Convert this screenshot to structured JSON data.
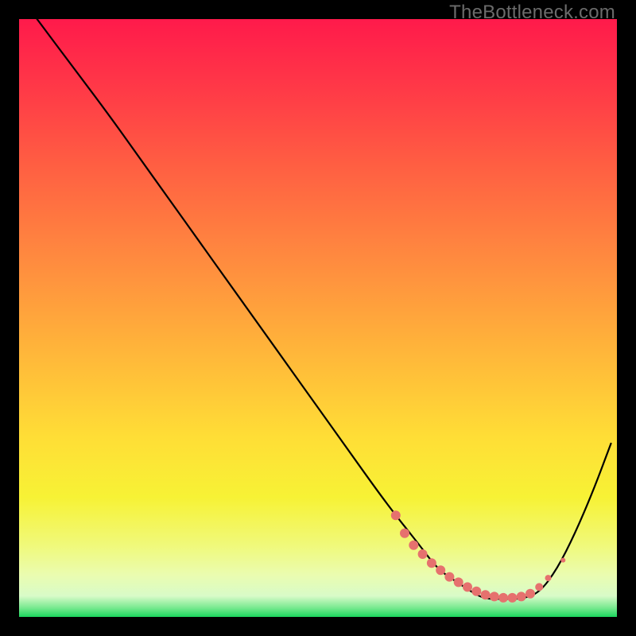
{
  "watermark": "TheBottleneck.com",
  "chart_data": {
    "type": "line",
    "title": "",
    "xlabel": "",
    "ylabel": "",
    "xlim": [
      0,
      100
    ],
    "ylim": [
      0,
      100
    ],
    "series": [
      {
        "name": "curve",
        "x": [
          3,
          9,
          15,
          20,
          25,
          30,
          35,
          40,
          45,
          50,
          55,
          60,
          63,
          67,
          70,
          73,
          76,
          78,
          81,
          84,
          87,
          90,
          93,
          96,
          99
        ],
        "y": [
          100,
          92,
          84,
          77,
          70,
          63,
          56,
          49,
          42,
          35,
          28,
          21,
          17,
          12,
          8,
          6,
          4,
          3,
          3,
          3,
          4,
          8,
          14,
          21,
          29
        ],
        "color": "#000000"
      }
    ],
    "markers": {
      "name": "highlighted-points",
      "color": "#e6716e",
      "x": [
        63.0,
        64.5,
        66.0,
        67.5,
        69.0,
        70.5,
        72.0,
        73.5,
        75.0,
        76.5,
        78.0,
        79.5,
        81.0,
        82.5,
        84.0,
        85.5,
        87.0,
        88.5,
        91.0
      ],
      "y": [
        17.0,
        14.0,
        12.0,
        10.5,
        9.0,
        7.8,
        6.7,
        5.8,
        5.0,
        4.3,
        3.7,
        3.4,
        3.2,
        3.2,
        3.4,
        3.9,
        5.0,
        6.5,
        9.5
      ],
      "r": [
        6,
        6,
        6,
        6,
        6,
        6,
        6,
        6,
        6,
        6,
        6,
        6,
        6,
        6,
        6,
        6,
        5,
        4,
        3
      ]
    },
    "gradient_stops": [
      {
        "offset": 0.0,
        "color": "#ff1a4b"
      },
      {
        "offset": 0.12,
        "color": "#ff3a47"
      },
      {
        "offset": 0.25,
        "color": "#ff6042"
      },
      {
        "offset": 0.4,
        "color": "#ff8a3f"
      },
      {
        "offset": 0.55,
        "color": "#ffb43a"
      },
      {
        "offset": 0.7,
        "color": "#ffde36"
      },
      {
        "offset": 0.8,
        "color": "#f7f235"
      },
      {
        "offset": 0.88,
        "color": "#f0f97a"
      },
      {
        "offset": 0.93,
        "color": "#eafcb0"
      },
      {
        "offset": 0.965,
        "color": "#d8fbc8"
      },
      {
        "offset": 0.985,
        "color": "#77e98f"
      },
      {
        "offset": 1.0,
        "color": "#1bd65e"
      }
    ]
  }
}
